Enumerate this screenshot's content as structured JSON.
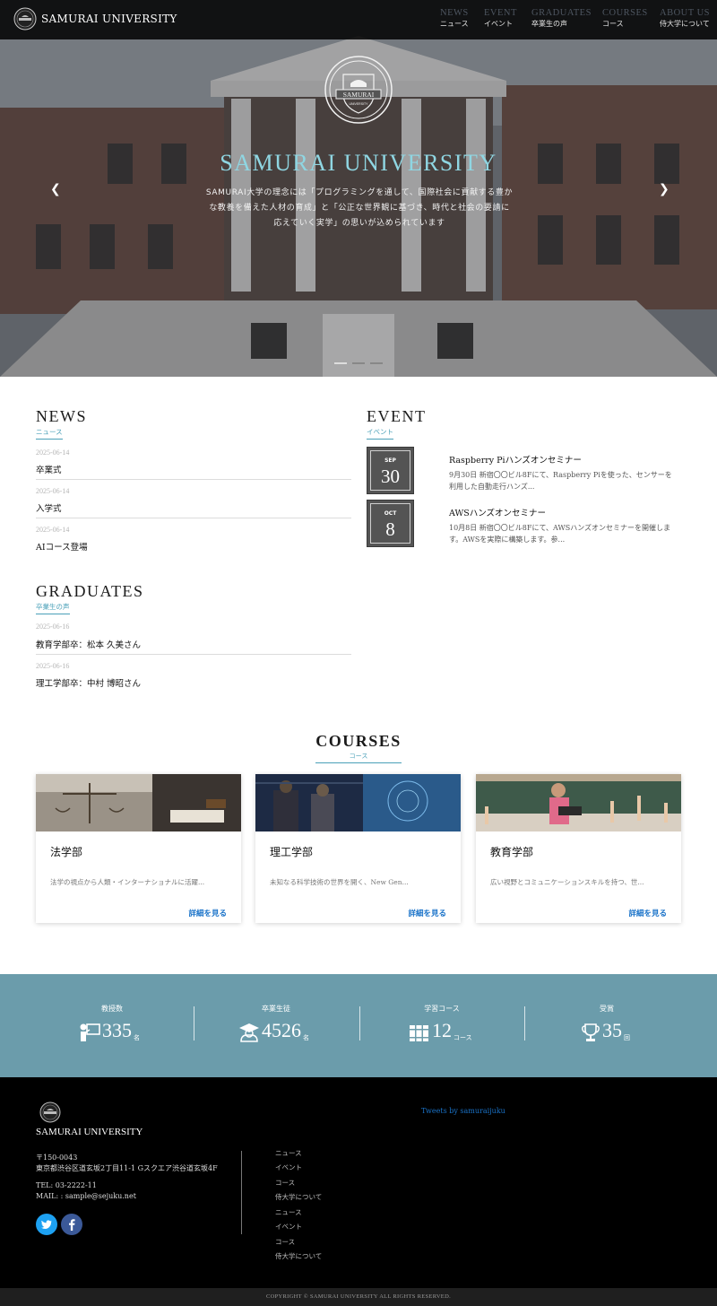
{
  "header": {
    "logo_text": "SAMURAI UNIVERSITY",
    "nav": [
      {
        "en": "NEWS",
        "ja": "ニュース"
      },
      {
        "en": "EVENT",
        "ja": "イベント"
      },
      {
        "en": "GRADUATES",
        "ja": "卒業生の声"
      },
      {
        "en": "COURSES",
        "ja": "コース"
      },
      {
        "en": "ABOUT US",
        "ja": "侍大学について"
      }
    ]
  },
  "hero": {
    "emblem_text": "SAMURAI",
    "emblem_sub": "UNIVERSITY",
    "title": "SAMURAI UNIVERSITY",
    "desc_lines": [
      "SAMURAI大学の理念には「プログラミングを通して、国際社会に貢献する豊か",
      "な教養を備えた人材の育成」と「公正な世界観に基づき、時代と社会の要請に",
      "応えていく実学」の思いが込められています"
    ],
    "prev_icon": "chevron-left-icon",
    "next_icon": "chevron-right-icon"
  },
  "news": {
    "title": "NEWS",
    "subtitle": "ニュース",
    "items": [
      {
        "date": "2025-06-14",
        "text": "卒業式"
      },
      {
        "date": "2025-06-14",
        "text": "入学式"
      },
      {
        "date": "2025-06-14",
        "text": "AIコース登場"
      }
    ]
  },
  "event": {
    "title": "EVENT",
    "subtitle": "イベント",
    "items": [
      {
        "month": "SEP",
        "day": "30",
        "title": "Raspberry Piハンズオンセミナー",
        "text_lines": [
          "9月30日 新宿〇〇ビル8Fにて、Raspberry Piを使った、センサーを",
          "利用した自動走行ハンズ..."
        ]
      },
      {
        "month": "OCT",
        "day": "8",
        "title": "AWSハンズオンセミナー",
        "text_lines": [
          "10月8日 新宿〇〇ビル8Fにて、AWSハンズオンセミナーを開催しま",
          "す。AWSを実際に構築します。参..."
        ]
      }
    ]
  },
  "graduates": {
    "title": "GRADUATES",
    "subtitle": "卒業生の声",
    "items": [
      {
        "date": "2025-06-16",
        "text": "教育学部卒：松本 久美さん"
      },
      {
        "date": "2025-06-16",
        "text": "理工学部卒：中村 博昭さん"
      }
    ]
  },
  "courses": {
    "title": "COURSES",
    "subtitle": "コース",
    "items": [
      {
        "name": "法学部",
        "desc": "法学の視点から人類・インターナショナルに活躍...",
        "link": "詳細を見る"
      },
      {
        "name": "理工学部",
        "desc": "未知なる科学技術の世界を開く、New Gen...",
        "link": "詳細を見る"
      },
      {
        "name": "教育学部",
        "desc": "広い視野とコミュニケーションスキルを持つ、世...",
        "link": "詳細を見る"
      }
    ]
  },
  "stats": [
    {
      "label": "教授数",
      "value": "335",
      "unit": "名",
      "icon": "teacher-icon"
    },
    {
      "label": "卒業生徒",
      "value": "4526",
      "unit": "名",
      "icon": "graduate-icon"
    },
    {
      "label": "学習コース",
      "value": "12",
      "unit": "コース",
      "icon": "books-icon"
    },
    {
      "label": "受賞",
      "value": "35",
      "unit": "回",
      "icon": "trophy-icon"
    }
  ],
  "footer": {
    "name": "SAMURAI UNIVERSITY",
    "postal": "〒150-0043",
    "address": "東京都渋谷区道玄坂2丁目11-1 Gスクエア渋谷道玄坂4F",
    "tel": "TEL: 03-2222-11",
    "mail": "MAIL: : sample@sejuku.net",
    "tweets_link": "Tweets by samuraijuku",
    "links": [
      "ニュース",
      "イベント",
      "コース",
      "侍大学について",
      "ニュース",
      "イベント",
      "コース",
      "侍大学について"
    ],
    "copyright": "COPYRIGHT © SAMURAI UNIVERSITY ALL RIGHTS RESERVED."
  },
  "colors": {
    "accent": "#4aa0b8",
    "stats_bg": "#6b9cab",
    "link": "#1a73c9",
    "hero_title": "#8fd6e2"
  }
}
